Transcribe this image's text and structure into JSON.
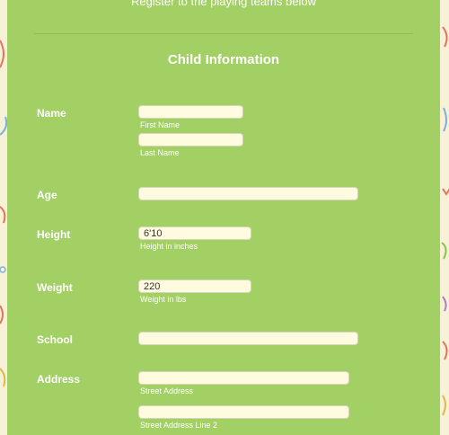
{
  "header": {
    "subtitle": "Register to the playing teams below"
  },
  "section": {
    "title": "Child Information"
  },
  "fields": {
    "name": {
      "label": "Name",
      "first_sub": "First Name",
      "last_sub": "Last Name",
      "first_value": "",
      "last_value": ""
    },
    "age": {
      "label": "Age",
      "value": ""
    },
    "height": {
      "label": "Height",
      "value": "6'10",
      "sub": "Height in inches"
    },
    "weight": {
      "label": "Weight",
      "value": "220",
      "sub": "Weight in lbs"
    },
    "school": {
      "label": "School",
      "value": ""
    },
    "address": {
      "label": "Address",
      "street_sub": "Street Address",
      "street2_sub": "Street Address Line 2",
      "street_value": "",
      "street2_value": ""
    }
  },
  "colors": {
    "panel": "#a3d065",
    "page_background": "#f7f1d8",
    "input_background": "#fffbe0"
  }
}
